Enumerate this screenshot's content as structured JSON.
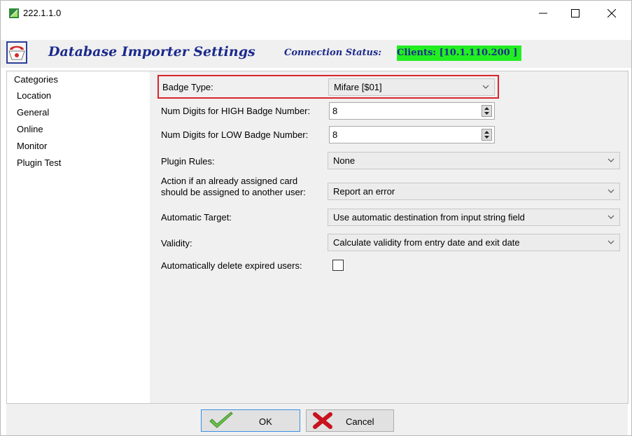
{
  "window": {
    "title": "222.1.1.0",
    "minimize_icon": "minimize-icon",
    "maximize_icon": "maximize-icon",
    "close_icon": "close-icon"
  },
  "header": {
    "title": "Database Importer Settings",
    "connection_label": "Connection Status:",
    "connection_value": "Clients: [10.1.110.200  ]",
    "connection_color": "#22ee22",
    "title_color": "#1c2a8c"
  },
  "sidebar": {
    "heading": "Categories",
    "items": [
      {
        "label": "Location"
      },
      {
        "label": "General"
      },
      {
        "label": "Online"
      },
      {
        "label": "Monitor"
      },
      {
        "label": "Plugin Test"
      }
    ]
  },
  "form": {
    "badge_type": {
      "label": "Badge Type:",
      "value": "Mifare [$01]"
    },
    "high_digits": {
      "label": "Num Digits for HIGH Badge Number:",
      "value": "8"
    },
    "low_digits": {
      "label": "Num Digits for LOW Badge Number:",
      "value": "8"
    },
    "plugin_rules": {
      "label": "Plugin Rules:",
      "value": "None"
    },
    "assigned_card": {
      "label_line1": "Action if an already assigned card",
      "label_line2": "should be assigned to another user:",
      "value": "Report an error"
    },
    "automatic_target": {
      "label": "Automatic Target:",
      "value": "Use automatic destination from input string field"
    },
    "validity": {
      "label": "Validity:",
      "value": "Calculate validity from entry date and exit date"
    },
    "delete_expired": {
      "label": "Automatically delete expired users:",
      "checked": false
    }
  },
  "highlight_color": "#d9262b",
  "footer": {
    "ok_label": "OK",
    "cancel_label": "Cancel",
    "ok_icon": "checkmark-icon",
    "cancel_icon": "red-x-icon"
  }
}
